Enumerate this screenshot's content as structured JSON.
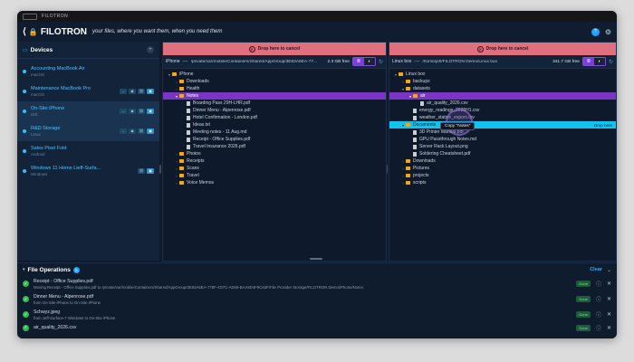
{
  "window": {
    "title": "FILOTRON"
  },
  "app": {
    "logo": "FILOTRON",
    "tagline": "your files, where you want them, when you need them",
    "avatar": "?"
  },
  "sidebar": {
    "title": "Devices",
    "items": [
      {
        "name": "Accounting MacBook Air",
        "os": "macOS"
      },
      {
        "name": "Maintenance MacBook Pro",
        "os": "macOS"
      },
      {
        "name": "On-Site iPhone",
        "os": "iOS"
      },
      {
        "name": "R&D Storage",
        "os": "Linux"
      },
      {
        "name": "Sales Pixel Fold",
        "os": "Android"
      },
      {
        "name": "Windows 11 Home Lieff-Surfa...",
        "os": "Windows"
      }
    ]
  },
  "left_pane": {
    "cancel": "Drop here to cancel",
    "device": "iPhone",
    "path": "/private/var/mobile/Containers/Shared/AppGroup/3E83A6EA-77...",
    "free": "2.3 GB free",
    "tree": [
      {
        "label": "iPhone",
        "type": "root"
      },
      {
        "label": "Downloads",
        "type": "folder"
      },
      {
        "label": "Health",
        "type": "folder"
      },
      {
        "label": "Notes",
        "type": "folder"
      },
      {
        "label": "Boarding Pass 29H-LHR.pdf",
        "type": "file"
      },
      {
        "label": "Dinner Menu - Alpenrose.pdf",
        "type": "file"
      },
      {
        "label": "Hotel Confirmation - London.pdf",
        "type": "file"
      },
      {
        "label": "Ideas.txt",
        "type": "file"
      },
      {
        "label": "Meeting notes - 11 Aug.md",
        "type": "file"
      },
      {
        "label": "Receipt - Office Supplies.pdf",
        "type": "file"
      },
      {
        "label": "Travel Insurance 2026.pdf",
        "type": "file"
      },
      {
        "label": "Photos",
        "type": "folder"
      },
      {
        "label": "Receipts",
        "type": "folder"
      },
      {
        "label": "Scans",
        "type": "folder"
      },
      {
        "label": "Travel",
        "type": "folder"
      },
      {
        "label": "Voice Memos",
        "type": "folder"
      }
    ]
  },
  "right_pane": {
    "cancel": "Drop here to cancel",
    "device": "Linux box",
    "path": "/home/jeff/FILOTRON Demo/Linux box",
    "free": "341.7 GB free",
    "tree": [
      {
        "label": "Linux box",
        "type": "root"
      },
      {
        "label": "backups",
        "type": "folder"
      },
      {
        "label": "datasets",
        "type": "folder"
      },
      {
        "label": "air",
        "type": "folder"
      },
      {
        "label": "air_quality_2026.csv",
        "type": "file"
      },
      {
        "label": "energy_readings_2026H1.csv",
        "type": "file"
      },
      {
        "label": "weather_station_export.csv",
        "type": "file"
      },
      {
        "label": "Documents",
        "type": "folder"
      },
      {
        "label": "3D Printer Manual.pdf",
        "type": "file"
      },
      {
        "label": "GPU Passthrough Notes.md",
        "type": "file"
      },
      {
        "label": "Server Rack Layout.png",
        "type": "file"
      },
      {
        "label": "Soldering Cheatsheet.pdf",
        "type": "file"
      },
      {
        "label": "Downloads",
        "type": "folder"
      },
      {
        "label": "Pictures",
        "type": "folder"
      },
      {
        "label": "projects",
        "type": "folder"
      },
      {
        "label": "scripts",
        "type": "folder"
      }
    ],
    "drop_label": "Drop here",
    "tooltip": "Copy \"Notes\""
  },
  "ops": {
    "title": "File Operations",
    "count": "5",
    "clear": "Clear",
    "items": [
      {
        "title": "Receipt - Office Supplies.pdf",
        "detail": "Moving Receipt - Office Supplies.pdf to /private/var/mobile/Containers/Shared/AppGroup/3E83A6EA-778F-4D7C-AD05-BAA8D4F9C63F/File Provider Storage/FILOTRON Demo/iPhone/Notes",
        "status": "Done"
      },
      {
        "title": "Dinner Menu - Alpenrose.pdf",
        "detail": "from On-Site iPhone to On-Site iPhone",
        "status": "Done"
      },
      {
        "title": "Schwyz.jpeg",
        "detail": "from Jeff-Surface-7 Windows to On-Site iPhone",
        "status": "Done"
      },
      {
        "title": "air_quality_2026.csv",
        "detail": "",
        "status": "Done"
      }
    ]
  }
}
